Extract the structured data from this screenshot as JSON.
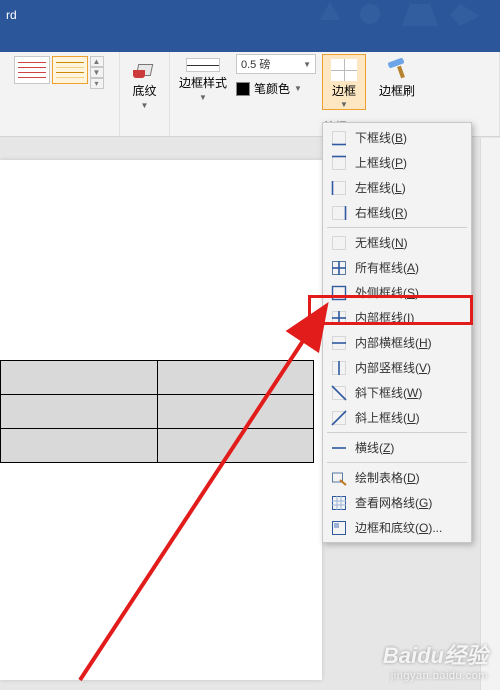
{
  "title": "rd",
  "ribbon": {
    "shading_label": "底纹",
    "border_style_label": "边框样式",
    "weight_value": "0.5 磅",
    "pen_color_label": "笔颜色",
    "group_label": "边框",
    "borders_btn_label": "边框",
    "painter_label": "边框刷"
  },
  "menu": {
    "items": [
      {
        "id": "bottom",
        "label": "下框线(B)",
        "key": "B",
        "icon": "border-bottom"
      },
      {
        "id": "top",
        "label": "上框线(P)",
        "key": "P",
        "icon": "border-top"
      },
      {
        "id": "left",
        "label": "左框线(L)",
        "key": "L",
        "icon": "border-left"
      },
      {
        "id": "right",
        "label": "右框线(R)",
        "key": "R",
        "icon": "border-right"
      },
      {
        "id": "sep1",
        "sep": true
      },
      {
        "id": "none",
        "label": "无框线(N)",
        "key": "N",
        "icon": "border-none"
      },
      {
        "id": "all",
        "label": "所有框线(A)",
        "key": "A",
        "icon": "border-all"
      },
      {
        "id": "outside",
        "label": "外侧框线(S)",
        "key": "S",
        "icon": "border-outside"
      },
      {
        "id": "inside",
        "label": "内部框线(I)",
        "key": "I",
        "icon": "border-inside",
        "highlighted": true
      },
      {
        "id": "inside-h",
        "label": "内部横框线(H)",
        "key": "H",
        "icon": "border-inside-h"
      },
      {
        "id": "inside-v",
        "label": "内部竖框线(V)",
        "key": "V",
        "icon": "border-inside-v"
      },
      {
        "id": "diag-down",
        "label": "斜下框线(W)",
        "key": "W",
        "icon": "border-diag-down"
      },
      {
        "id": "diag-up",
        "label": "斜上框线(U)",
        "key": "U",
        "icon": "border-diag-up"
      },
      {
        "id": "sep2",
        "sep": true
      },
      {
        "id": "hline",
        "label": "横线(Z)",
        "key": "Z",
        "icon": "horizontal-line"
      },
      {
        "id": "sep3",
        "sep": true
      },
      {
        "id": "draw",
        "label": "绘制表格(D)",
        "key": "D",
        "icon": "draw-table"
      },
      {
        "id": "gridlines",
        "label": "查看网格线(G)",
        "key": "G",
        "icon": "view-gridlines"
      },
      {
        "id": "dialog",
        "label": "边框和底纹(O)...",
        "key": "O",
        "icon": "borders-shading"
      }
    ]
  },
  "watermark": {
    "brand": "Baidu经验",
    "sub": "jingyan.baidu.com"
  }
}
